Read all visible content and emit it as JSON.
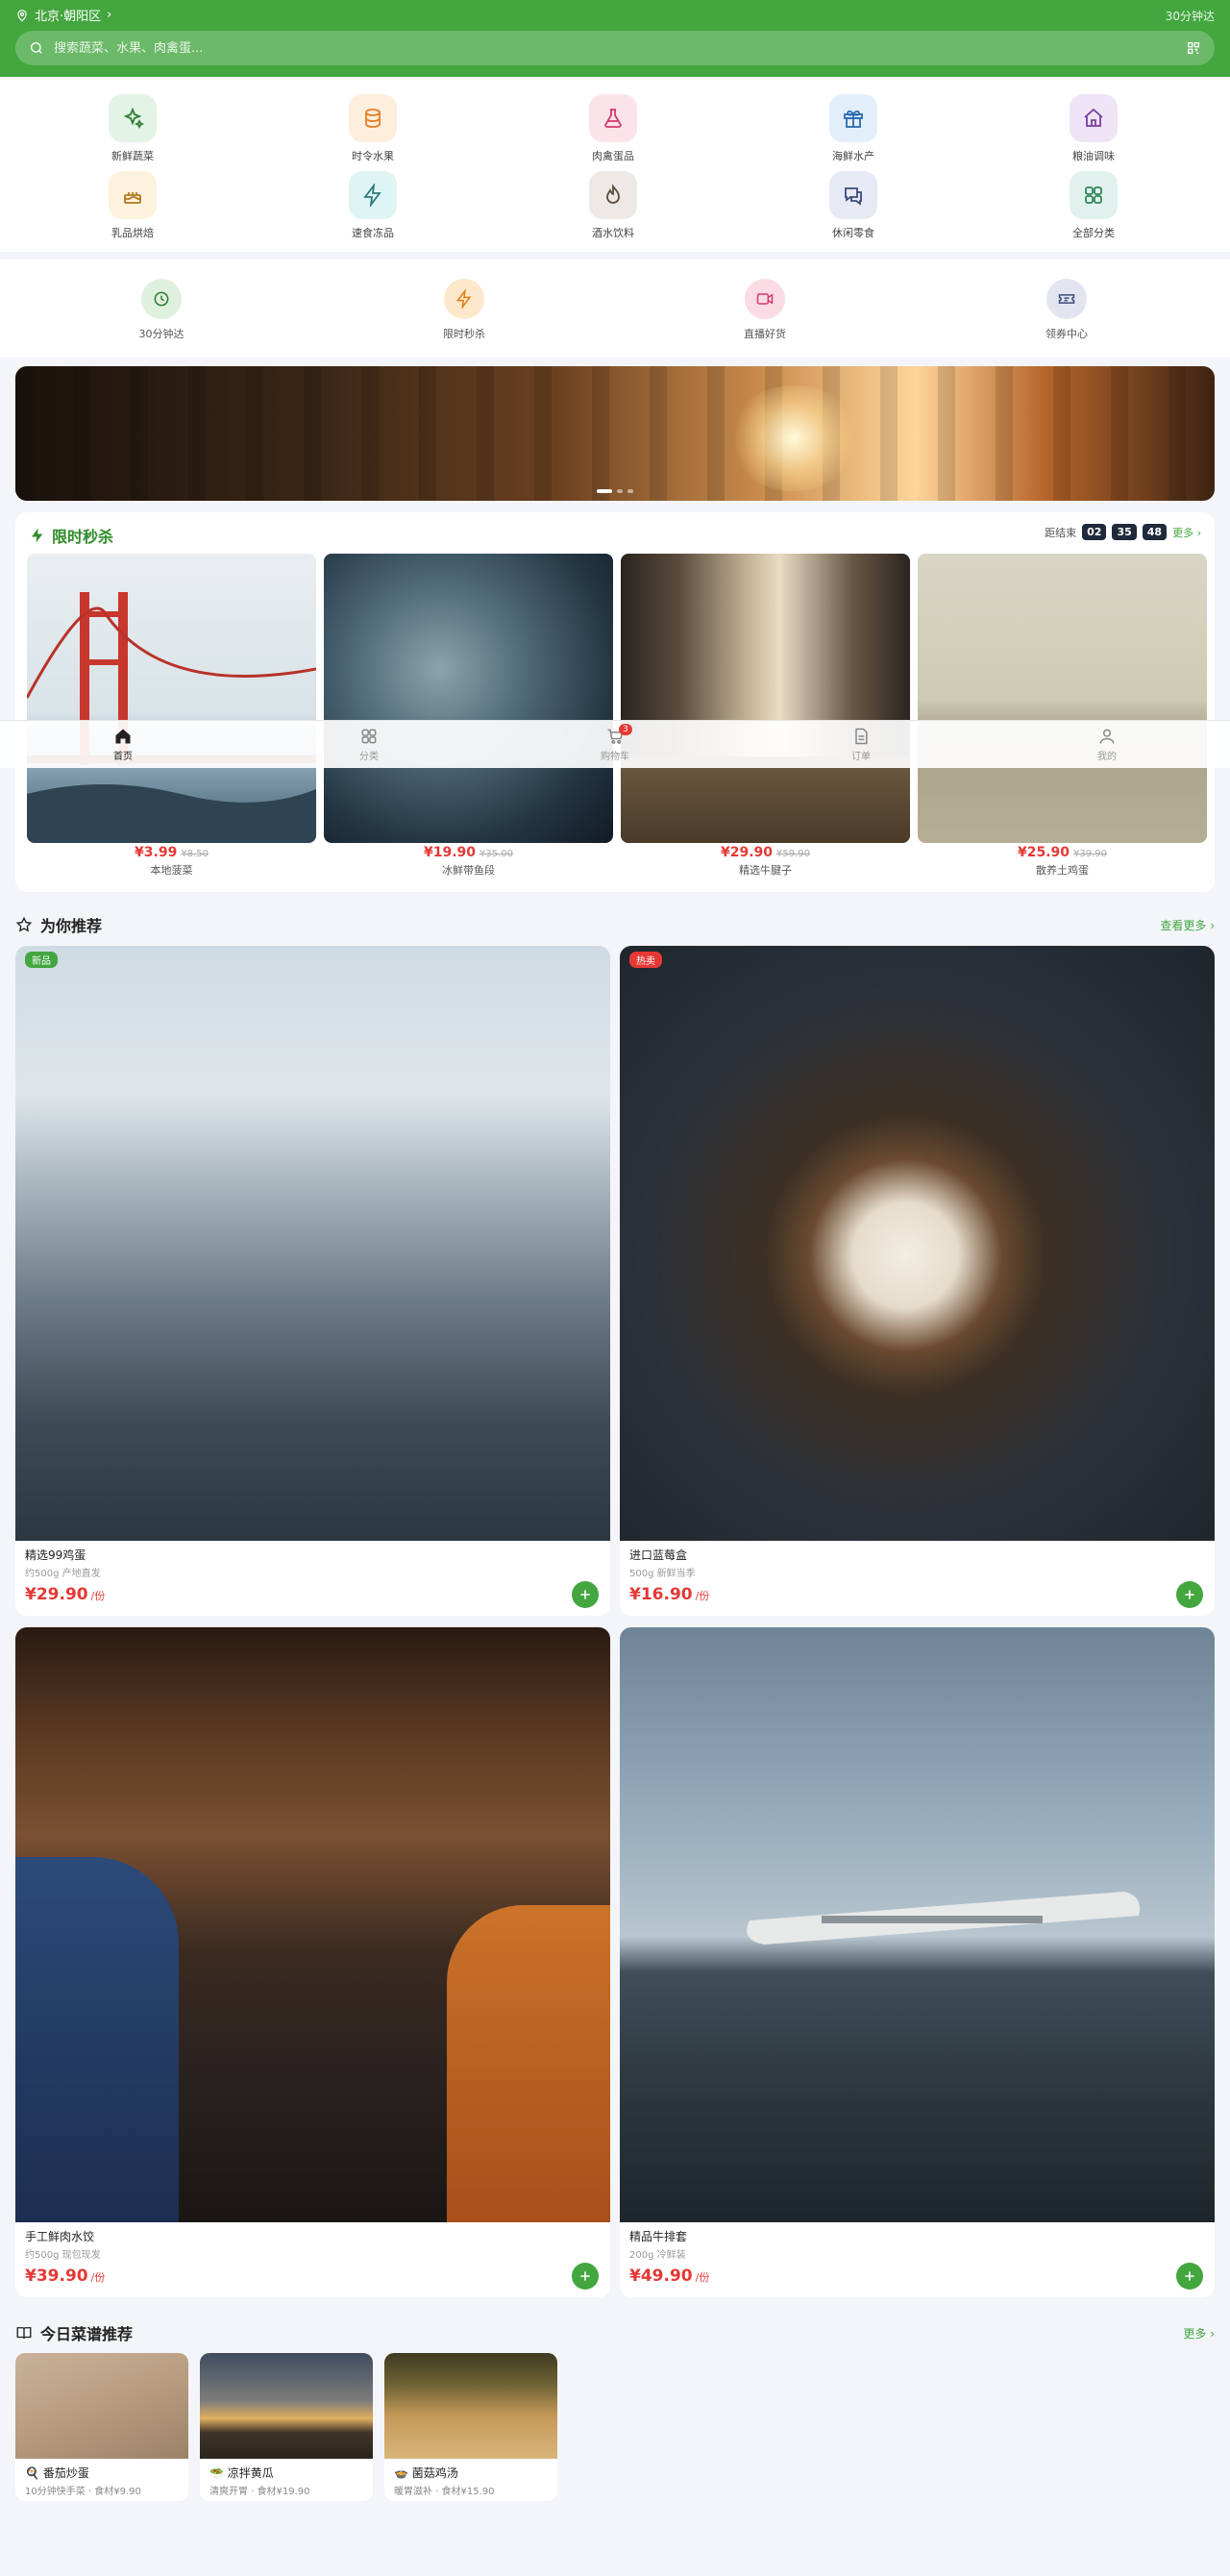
{
  "header": {
    "location": "北京·朝阳区",
    "delivery": "30分钟达",
    "search_placeholder": "搜索蔬菜、水果、肉禽蛋..."
  },
  "categories": [
    {
      "label": "新鲜蔬菜",
      "icon": "sparkles-icon",
      "bg": "#e3f3e6",
      "fg": "#2e7d32"
    },
    {
      "label": "时令水果",
      "icon": "coins-icon",
      "bg": "#fdeedd",
      "fg": "#e67e22"
    },
    {
      "label": "肉禽蛋品",
      "icon": "flask-icon",
      "bg": "#fbe3ea",
      "fg": "#d23a6a"
    },
    {
      "label": "海鲜水产",
      "icon": "gift-icon",
      "bg": "#e2eefa",
      "fg": "#2b6cb0"
    },
    {
      "label": "粮油调味",
      "icon": "home-icon",
      "bg": "#efe4f6",
      "fg": "#7b3fa0"
    },
    {
      "label": "乳品烘焙",
      "icon": "cake-icon",
      "bg": "#fdf2dc",
      "fg": "#b7791f"
    },
    {
      "label": "速食冻品",
      "icon": "bolt-icon",
      "bg": "#dff4f4",
      "fg": "#2c7a7b"
    },
    {
      "label": "酒水饮料",
      "icon": "flame-icon",
      "bg": "#ece9e6",
      "fg": "#5a4a3a"
    },
    {
      "label": "休闲零食",
      "icon": "chat-icon",
      "bg": "#e7e9f4",
      "fg": "#3b4a7a"
    },
    {
      "label": "全部分类",
      "icon": "grid-icon",
      "bg": "#e1f2ee",
      "fg": "#2f855a"
    }
  ],
  "quick": [
    {
      "label": "30分钟达",
      "icon": "clock-icon",
      "bg": "#dff0df",
      "fg": "#2e7d32"
    },
    {
      "label": "限时秒杀",
      "icon": "bolt-icon",
      "bg": "#fde8cc",
      "fg": "#e07b12"
    },
    {
      "label": "直播好货",
      "icon": "video-icon",
      "bg": "#fbdbe4",
      "fg": "#d23a6a"
    },
    {
      "label": "领券中心",
      "icon": "ticket-icon",
      "bg": "#e2e4ef",
      "fg": "#3b4a7a"
    }
  ],
  "flash": {
    "title": "限时秒杀",
    "countdown_label": "距结束",
    "hours": "02",
    "minutes": "35",
    "seconds": "48",
    "more": "更多 ›",
    "items": [
      {
        "price": "¥3.99",
        "old": "¥8.50",
        "name": "本地菠菜"
      },
      {
        "price": "¥19.90",
        "old": "¥35.00",
        "name": "冰鲜带鱼段"
      },
      {
        "price": "¥29.90",
        "old": "¥59.90",
        "name": "精选牛腱子"
      },
      {
        "price": "¥25.90",
        "old": "¥39.90",
        "name": "散养土鸡蛋"
      }
    ]
  },
  "nav": [
    {
      "label": "首页",
      "icon": "home-icon",
      "active": true
    },
    {
      "label": "分类",
      "icon": "grid-icon"
    },
    {
      "label": "购物车",
      "icon": "cart-icon",
      "badge": "3"
    },
    {
      "label": "订单",
      "icon": "doc-icon"
    },
    {
      "label": "我的",
      "icon": "user-icon"
    }
  ],
  "recommend": {
    "title": "为你推荐",
    "more": "查看更多 ›",
    "items": [
      {
        "tag": "新品",
        "tag_color": "#43a63f",
        "name": "精选99鸡蛋",
        "spec": "约500g 产地直发",
        "price": "¥29.90",
        "unit": "/份"
      },
      {
        "tag": "热卖",
        "tag_color": "#e53935",
        "name": "进口蓝莓盒",
        "spec": "500g 新鲜当季",
        "price": "¥16.90",
        "unit": "/份"
      },
      {
        "tag": "",
        "tag_color": "",
        "name": "手工鲜肉水饺",
        "spec": "约500g 现包现发",
        "price": "¥39.90",
        "unit": "/份"
      },
      {
        "tag": "",
        "tag_color": "",
        "name": "精品牛排套",
        "spec": "200g 冷鲜装",
        "price": "¥49.90",
        "unit": "/份"
      }
    ]
  },
  "recipes": {
    "title": "今日菜谱推荐",
    "more": "更多 ›",
    "items": [
      {
        "title": "🍳 番茄炒蛋",
        "sub": "10分钟快手菜 · 食材¥9.90"
      },
      {
        "title": "🥗 凉拌黄瓜",
        "sub": "清爽开胃 · 食材¥19.90"
      },
      {
        "title": "🍲 菌菇鸡汤",
        "sub": "暖胃滋补 · 食材¥15.90"
      }
    ]
  }
}
